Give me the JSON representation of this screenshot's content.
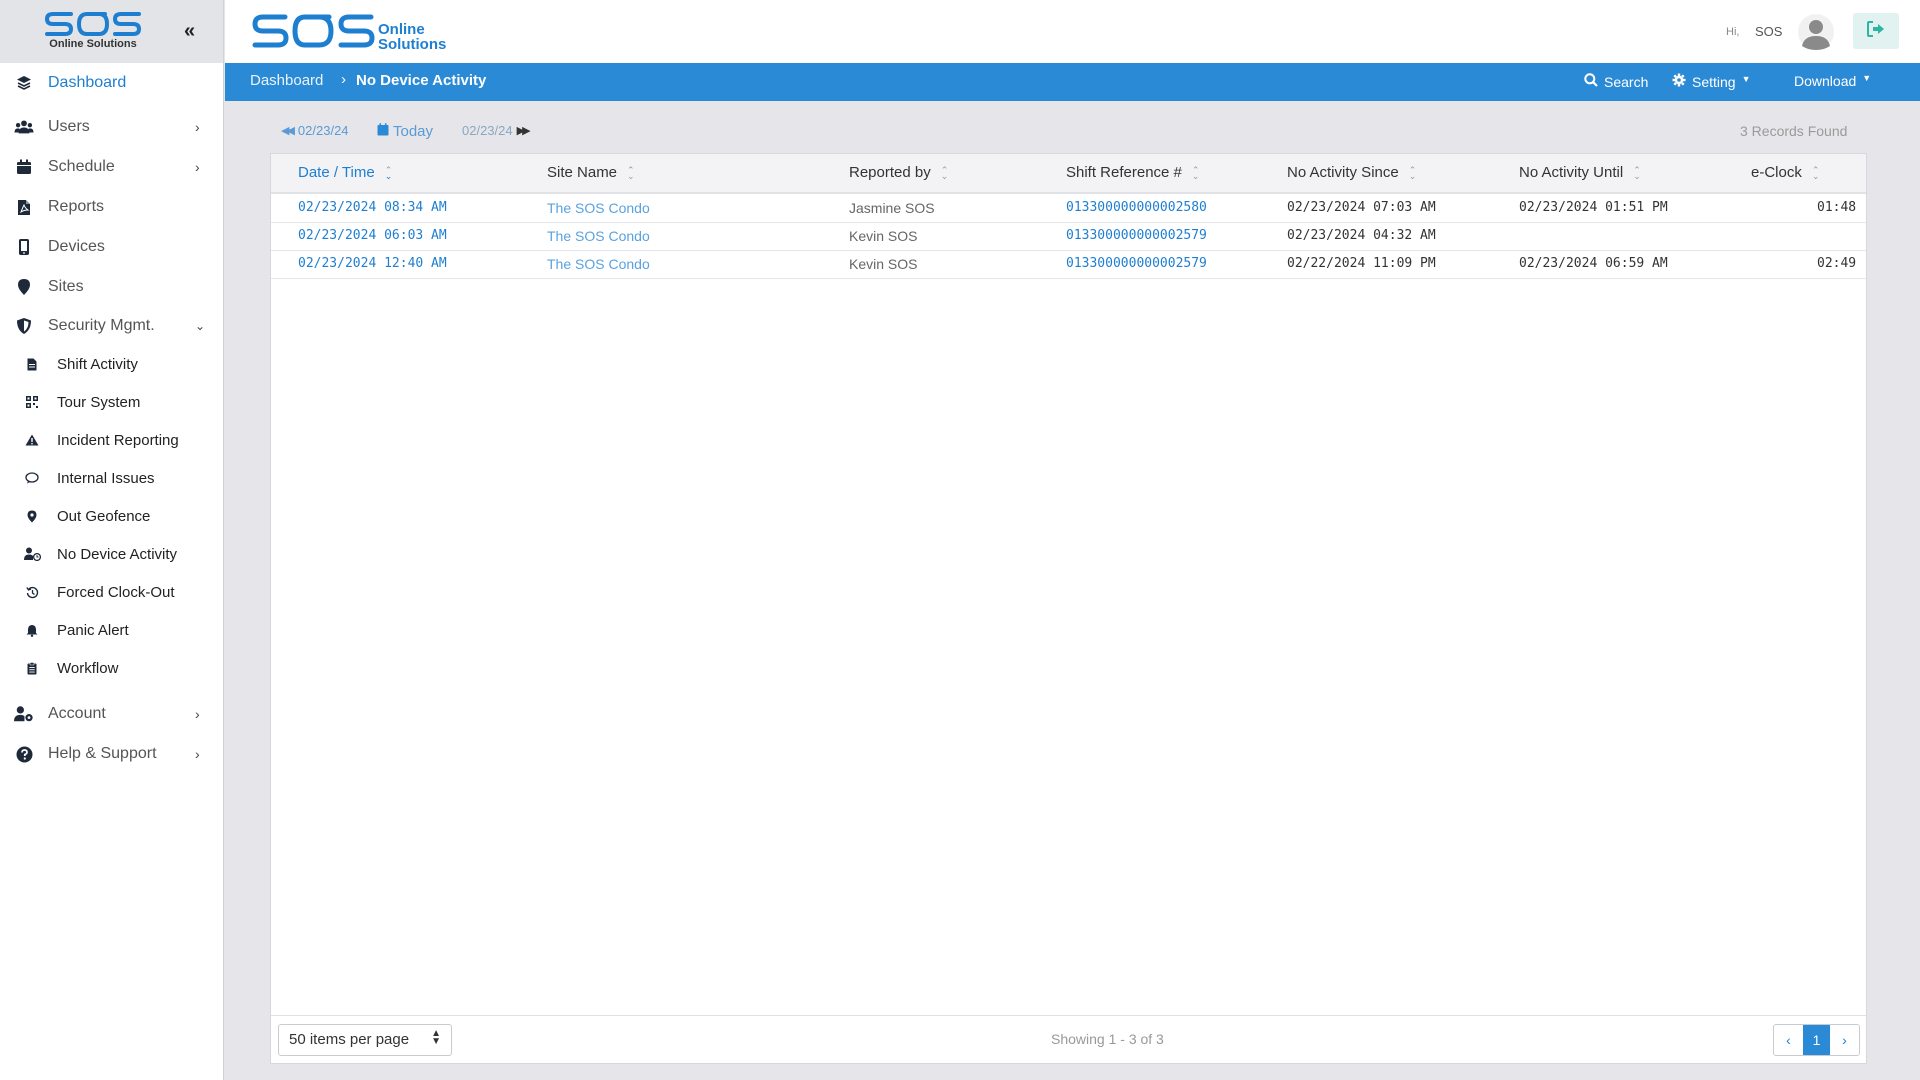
{
  "sidebar": {
    "brand_sub": "Online Solutions",
    "items": [
      {
        "label": "Dashboard",
        "icon": "layers-icon"
      },
      {
        "label": "Users",
        "icon": "users-icon"
      },
      {
        "label": "Schedule",
        "icon": "calendar-icon"
      },
      {
        "label": "Reports",
        "icon": "pdf-file-icon"
      },
      {
        "label": "Devices",
        "icon": "mobile-icon"
      },
      {
        "label": "Sites",
        "icon": "map-pin-icon"
      },
      {
        "label": "Security Mgmt.",
        "icon": "shield-icon"
      },
      {
        "label": "Account",
        "icon": "user-gear-icon"
      },
      {
        "label": "Help & Support",
        "icon": "question-circle-icon"
      }
    ],
    "security_sub": [
      {
        "label": "Shift Activity",
        "icon": "document-icon"
      },
      {
        "label": "Tour System",
        "icon": "qr-code-icon"
      },
      {
        "label": "Incident Reporting",
        "icon": "warning-icon"
      },
      {
        "label": "Internal Issues",
        "icon": "comment-icon"
      },
      {
        "label": "Out Geofence",
        "icon": "location-icon"
      },
      {
        "label": "No Device Activity",
        "icon": "user-clock-icon"
      },
      {
        "label": "Forced Clock-Out",
        "icon": "history-icon"
      },
      {
        "label": "Panic Alert",
        "icon": "bell-icon"
      },
      {
        "label": "Workflow",
        "icon": "clipboard-icon"
      }
    ]
  },
  "header": {
    "logo_line1": "Online",
    "logo_line2": "Solutions",
    "greeting": "Hi,",
    "username": "SOS"
  },
  "breadcrumb": {
    "home": "Dashboard",
    "current": "No Device Activity"
  },
  "toolbar": {
    "search": "Search",
    "setting": "Setting",
    "download": "Download"
  },
  "datenav": {
    "prev": "02/23/24",
    "today": "Today",
    "next": "02/23/24",
    "records": "3 Records Found"
  },
  "table": {
    "columns": [
      "Date / Time",
      "Site Name",
      "Reported by",
      "Shift Reference #",
      "No Activity Since",
      "No Activity Until",
      "e-Clock"
    ],
    "rows": [
      [
        "02/23/2024 08:34 AM",
        "The SOS Condo",
        "Jasmine SOS",
        "013300000000002580",
        "02/23/2024 07:03 AM",
        "02/23/2024 01:51 PM",
        "01:48"
      ],
      [
        "02/23/2024 06:03 AM",
        "The SOS Condo",
        "Kevin SOS",
        "013300000000002579",
        "02/23/2024 04:32 AM",
        "",
        ""
      ],
      [
        "02/23/2024 12:40 AM",
        "The SOS Condo",
        "Kevin SOS",
        "013300000000002579",
        "02/22/2024 11:09 PM",
        "02/23/2024 06:59 AM",
        "02:49"
      ]
    ]
  },
  "footer": {
    "per_page": "50 items per page",
    "showing": "Showing 1 - 3 of 3",
    "page": "1"
  },
  "colors": {
    "accent": "#2b8ad6",
    "link": "#1e7fd1",
    "sidebar_bg": "#ffffff",
    "content_bg": "#e6e6ea"
  }
}
